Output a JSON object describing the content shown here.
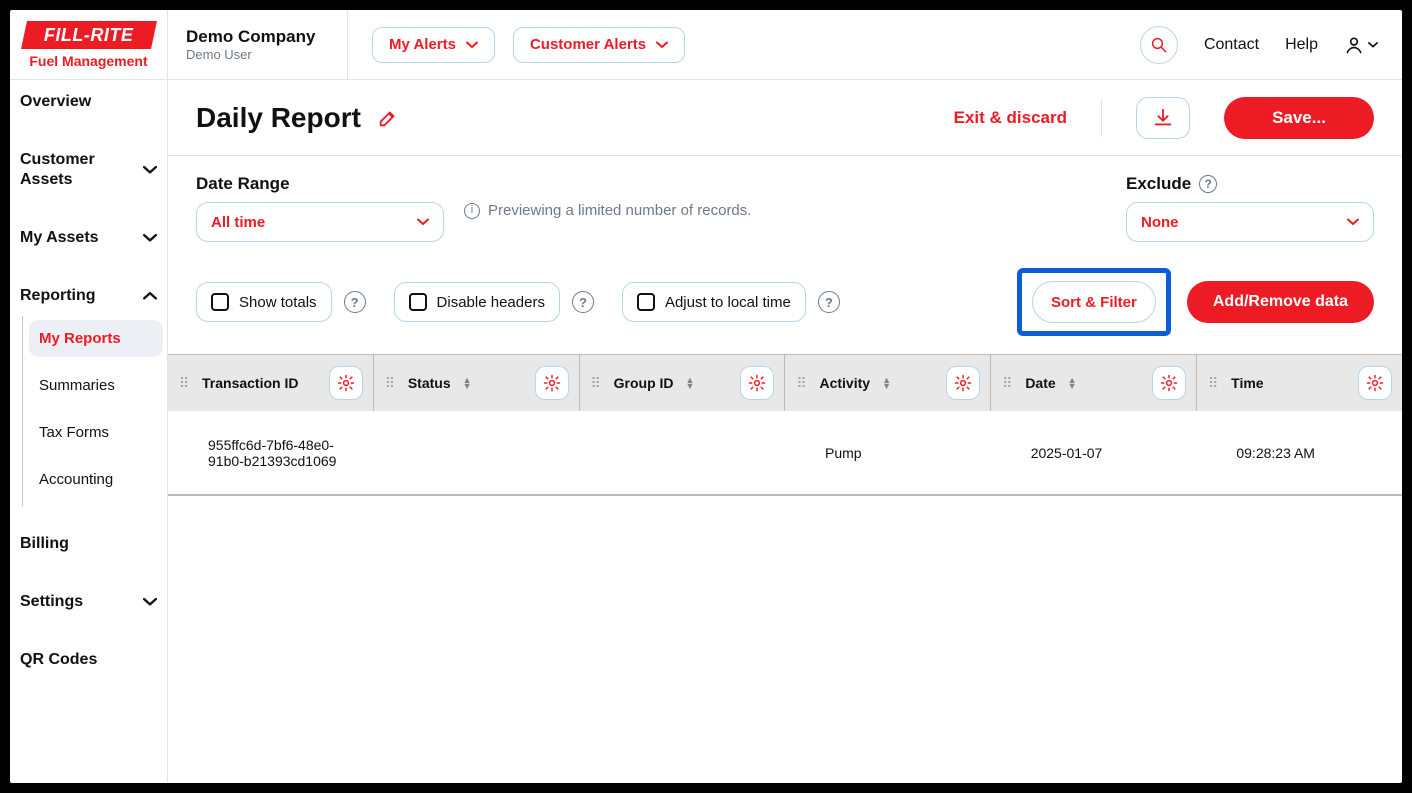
{
  "brand": {
    "name": "FILL-RITE",
    "subtitle": "Fuel Management"
  },
  "company": {
    "name": "Demo Company",
    "user": "Demo User"
  },
  "topbar": {
    "my_alerts": "My Alerts",
    "customer_alerts": "Customer Alerts",
    "contact": "Contact",
    "help": "Help"
  },
  "sidebar": {
    "items": [
      {
        "label": "Overview",
        "expandable": false
      },
      {
        "label": "Customer Assets",
        "expandable": true,
        "open": false
      },
      {
        "label": "My Assets",
        "expandable": true,
        "open": false
      },
      {
        "label": "Reporting",
        "expandable": true,
        "open": true,
        "children": [
          {
            "label": "My Reports",
            "active": true
          },
          {
            "label": "Summaries"
          },
          {
            "label": "Tax Forms"
          },
          {
            "label": "Accounting"
          }
        ]
      },
      {
        "label": "Billing",
        "expandable": false
      },
      {
        "label": "Settings",
        "expandable": true,
        "open": false
      },
      {
        "label": "QR Codes",
        "expandable": false
      }
    ]
  },
  "page": {
    "title": "Daily Report",
    "exit": "Exit & discard",
    "save": "Save..."
  },
  "filters": {
    "date_range_label": "Date Range",
    "date_range_value": "All time",
    "preview_note": "Previewing a limited number of records.",
    "exclude_label": "Exclude",
    "exclude_value": "None",
    "show_totals": "Show totals",
    "disable_headers": "Disable headers",
    "adjust_local_time": "Adjust to local time",
    "sort_filter": "Sort & Filter",
    "add_remove": "Add/Remove data"
  },
  "table": {
    "columns": [
      "Transaction ID",
      "Status",
      "Group ID",
      "Activity",
      "Date",
      "Time"
    ],
    "rows": [
      {
        "transaction_id": "955ffc6d-7bf6-48e0-91b0-b21393cd1069",
        "status": "",
        "group_id": "",
        "activity": "Pump",
        "date": "2025-01-07",
        "time": "09:28:23 AM"
      }
    ]
  }
}
